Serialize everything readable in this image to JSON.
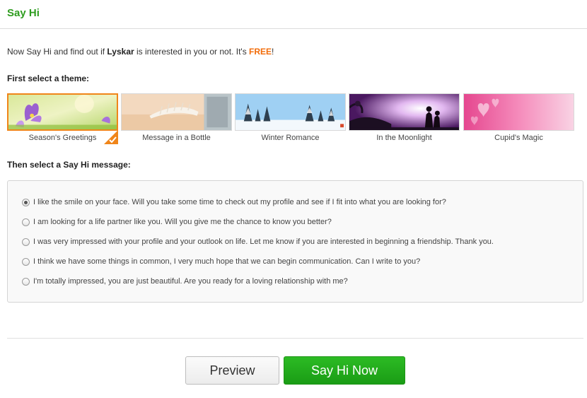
{
  "header": {
    "title": "Say Hi"
  },
  "intro": {
    "prefix": "Now Say Hi and find out if ",
    "name": "Lyskar",
    "middle": " is interested in you or not. It's ",
    "free": "FREE",
    "suffix": "!"
  },
  "theme_section": {
    "label": "First select a theme:",
    "selected_index": 0,
    "themes": [
      {
        "caption": "Season's Greetings",
        "icon": "flower-spring-image"
      },
      {
        "caption": "Message in a Bottle",
        "icon": "seashell-beach-image"
      },
      {
        "caption": "Winter Romance",
        "icon": "snowy-trees-image"
      },
      {
        "caption": "In the Moonlight",
        "icon": "couple-silhouette-image"
      },
      {
        "caption": "Cupid's Magic",
        "icon": "pink-hearts-image"
      }
    ]
  },
  "message_section": {
    "label": "Then select a Say Hi message:",
    "selected_index": 0,
    "messages": [
      "I like the smile on your face. Will you take some time to check out my profile and see if I fit into what you are looking for?",
      "I am looking for a life partner like you. Will you give me the chance to know you better?",
      "I was very impressed with your profile and your outlook on life. Let me know if you are interested in beginning a friendship. Thank you.",
      "I think we have some things in common, I very much hope that we can begin communication. Can I write to you?",
      "I'm totally impressed, you are just beautiful. Are you ready for a loving relationship with me?"
    ]
  },
  "buttons": {
    "preview": "Preview",
    "say_hi_now": "Say Hi Now"
  },
  "colors": {
    "brand_green": "#2e9c1f",
    "button_green": "#1a9c15",
    "free_orange": "#f26c0a",
    "selected_border": "#f08519"
  }
}
